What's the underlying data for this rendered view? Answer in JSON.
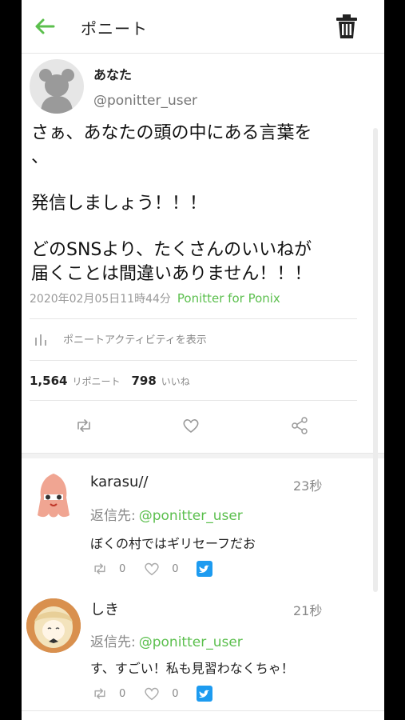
{
  "appbar": {
    "title": "ポニート"
  },
  "tweet": {
    "display_name": "あなた",
    "handle": "@ponitter_user",
    "body_lines": [
      "さぁ、あなたの頭の中にある言葉を",
      "、",
      "発信しましょう！！！",
      "どのSNSより、たくさんのいいねが",
      "届くことは間違いありません！！！"
    ],
    "timestamp": "2020年02月05日11時44分",
    "via": "Ponitter for Ponix",
    "activity_label": "ポニートアクティビティを表示",
    "repost_count": "1,564",
    "repost_label": "リポニート",
    "like_count": "798",
    "like_label": "いいね"
  },
  "replies": [
    {
      "name": "karasu//",
      "time": "23秒",
      "reply_to_label": "返信先:",
      "reply_to": "@ponitter_user",
      "text": "ぼくの村ではギリセーフだお",
      "reposts": "0",
      "likes": "0"
    },
    {
      "name": "しき",
      "time": "21秒",
      "reply_to_label": "返信先:",
      "reply_to": "@ponitter_user",
      "text": "す、すごい！私も見習わなくちゃ！",
      "reposts": "0",
      "likes": "0"
    }
  ],
  "colors": {
    "accent": "#5bbf4d",
    "twitter": "#1d9bf0"
  }
}
